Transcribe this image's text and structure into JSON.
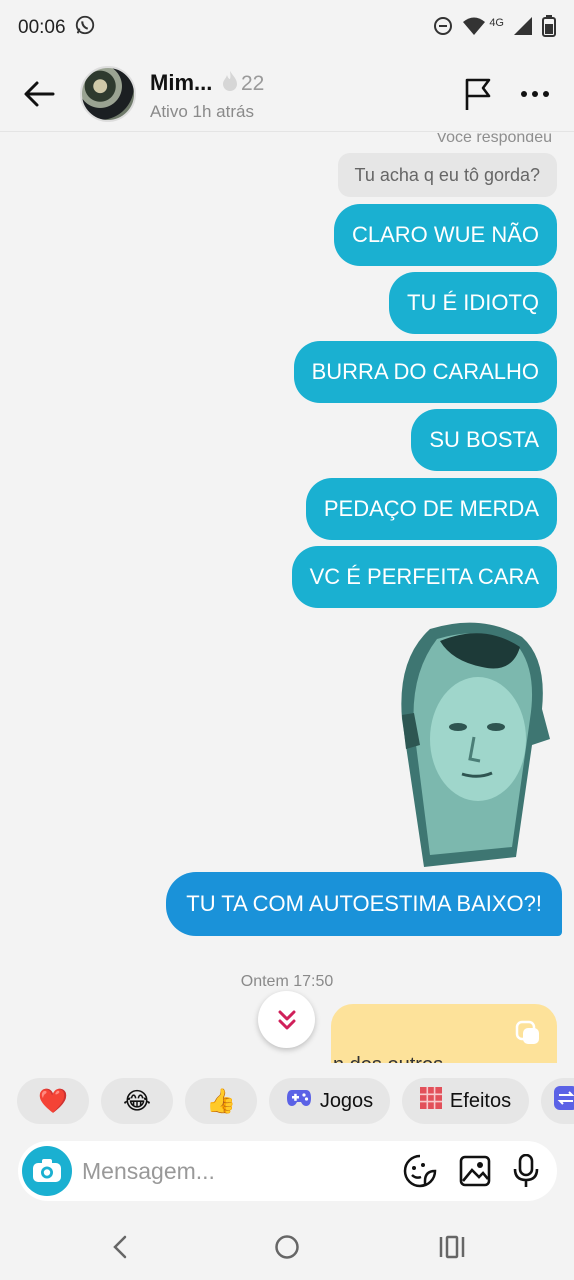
{
  "status_bar": {
    "time": "00:06",
    "network": "4G"
  },
  "header": {
    "contact_name": "Mim...",
    "streak_count": "22",
    "contact_status": "Ativo 1h atrás"
  },
  "chat": {
    "replied_label": "Você respondeu",
    "reply_preview": "Tu acha q eu tô gorda?",
    "messages": [
      "CLARO WUE NÃO",
      "TU É IDIOTQ",
      "BURRA DO CARALHO",
      "SU BOSTA",
      "PEDAÇO DE MERDA",
      "VC É PERFEITA CARA"
    ],
    "last_message": "TU TA COM AUTOESTIMA BAIXO?!",
    "timestamp": "Ontem 17:50",
    "snap_card_text": "n dos outros"
  },
  "reactions": {
    "heart": "❤️",
    "laugh": "😂",
    "thumbs": "👍",
    "games_label": "Jogos",
    "effects_label": "Efeitos"
  },
  "composer": {
    "placeholder": "Mensagem..."
  },
  "colors": {
    "bubble_sent": "#1ab0d1",
    "bubble_last": "#1a92d9",
    "background": "#f3f3f3",
    "snap_card": "#fde29a"
  }
}
